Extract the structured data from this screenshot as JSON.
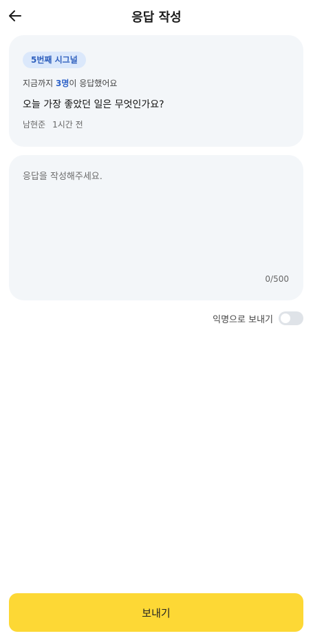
{
  "header": {
    "title": "응답 작성",
    "back_icon": "arrow-left-icon"
  },
  "signal": {
    "badge": "5번째 시그널",
    "response_prefix": "지금까지 ",
    "response_count": "3명",
    "response_suffix": "이 응답했어요",
    "question": "오늘 가장 좋았던 일은 무엇인가요?",
    "author": "남현준",
    "time": "1시간 전"
  },
  "answer": {
    "placeholder": "응답을 작성해주세요.",
    "value": "",
    "char_count": "0/500"
  },
  "anonymous": {
    "label": "익명으로 보내기",
    "enabled": false
  },
  "send_button": {
    "label": "보내기"
  },
  "colors": {
    "card_bg": "#f3f6f9",
    "badge_bg": "#dbe8fb",
    "accent_blue": "#2e62c8",
    "send_yellow": "#fdd835",
    "toggle_off": "#dfe3e8"
  }
}
